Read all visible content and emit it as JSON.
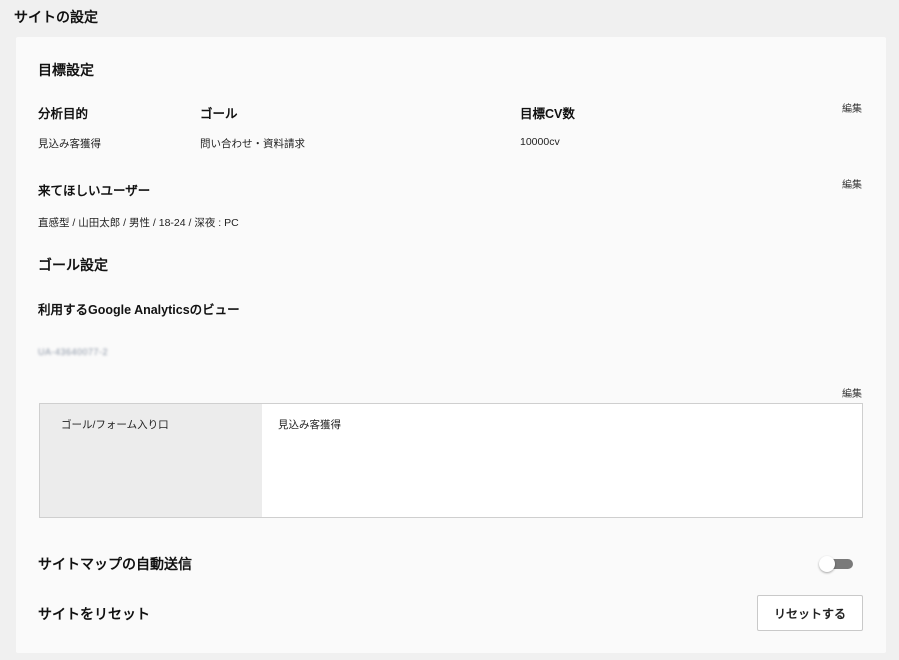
{
  "page": {
    "title": "サイトの設定"
  },
  "target": {
    "title": "目標設定",
    "edit_label": "編集",
    "columns": {
      "purpose_header": "分析目的",
      "goal_header": "ゴール",
      "cv_header": "目標CV数"
    },
    "values": {
      "purpose": "見込み客獲得",
      "goal": "問い合わせ・資料請求",
      "cv": "10000cv"
    }
  },
  "users": {
    "title": "来てほしいユーザー",
    "edit_label": "編集",
    "description": "直感型 / 山田太郎 / 男性 / 18-24 / 深夜 : PC"
  },
  "goal_settings": {
    "title": "ゴール設定",
    "ga_view_label": "利用するGoogle Analyticsのビュー",
    "ga_view_id": "UA-43640077-2",
    "edit_label": "編集",
    "table": {
      "header": "ゴール/フォーム入り口",
      "value": "見込み客獲得"
    }
  },
  "sitemap": {
    "label": "サイトマップの自動送信",
    "enabled": false
  },
  "reset": {
    "label": "サイトをリセット",
    "button_label": "リセットする"
  },
  "colors": {
    "background": "#f0f0f0",
    "card": "#fafafa",
    "toggle_track_off": "#7a7a7a"
  }
}
